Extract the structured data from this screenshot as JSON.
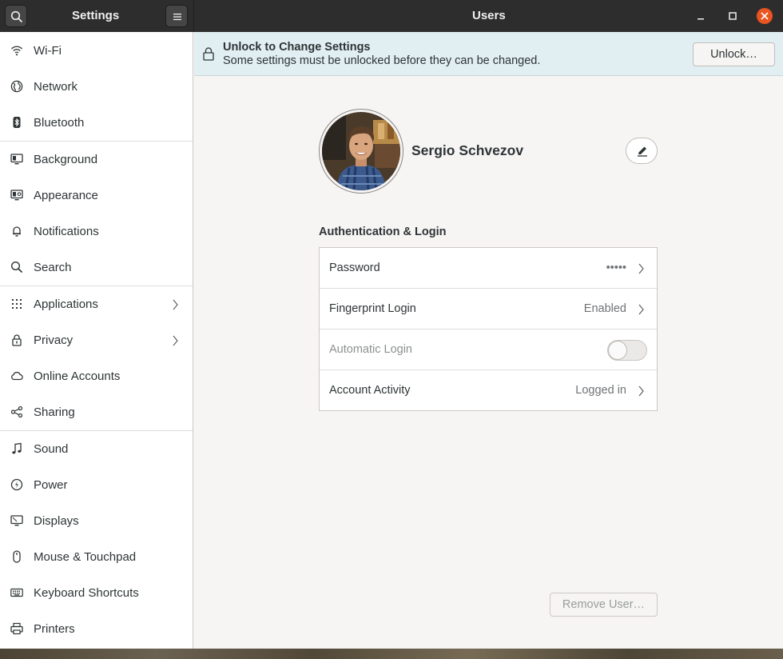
{
  "sidebar_title": "Settings",
  "window_title": "Users",
  "sidebar": {
    "items": [
      {
        "label": "Wi-Fi",
        "icon": "wifi-icon"
      },
      {
        "label": "Network",
        "icon": "globe-icon"
      },
      {
        "label": "Bluetooth",
        "icon": "bluetooth-icon"
      },
      {
        "label": "Background",
        "icon": "monitor-icon"
      },
      {
        "label": "Appearance",
        "icon": "appearance-icon"
      },
      {
        "label": "Notifications",
        "icon": "bell-icon"
      },
      {
        "label": "Search",
        "icon": "search-icon"
      },
      {
        "label": "Applications",
        "icon": "grid-icon"
      },
      {
        "label": "Privacy",
        "icon": "lock-icon"
      },
      {
        "label": "Online Accounts",
        "icon": "cloud-icon"
      },
      {
        "label": "Sharing",
        "icon": "share-icon"
      },
      {
        "label": "Sound",
        "icon": "music-note-icon"
      },
      {
        "label": "Power",
        "icon": "power-icon"
      },
      {
        "label": "Displays",
        "icon": "display-icon"
      },
      {
        "label": "Mouse & Touchpad",
        "icon": "mouse-icon"
      },
      {
        "label": "Keyboard Shortcuts",
        "icon": "keyboard-icon"
      },
      {
        "label": "Printers",
        "icon": "printer-icon"
      }
    ]
  },
  "infobar": {
    "title": "Unlock to Change Settings",
    "subtitle": "Some settings must be unlocked before they can be changed.",
    "button": "Unlock…"
  },
  "user": {
    "name": "Sergio Schvezov"
  },
  "auth": {
    "section_title": "Authentication & Login",
    "rows": [
      {
        "label": "Password",
        "value": "•••••"
      },
      {
        "label": "Fingerprint Login",
        "value": "Enabled"
      },
      {
        "label": "Automatic Login",
        "value": ""
      },
      {
        "label": "Account Activity",
        "value": "Logged in"
      }
    ]
  },
  "remove_button": "Remove User…",
  "colors": {
    "accent": "#e95420",
    "headerbar": "#2d2d2d",
    "infobar": "#e1eef2"
  }
}
